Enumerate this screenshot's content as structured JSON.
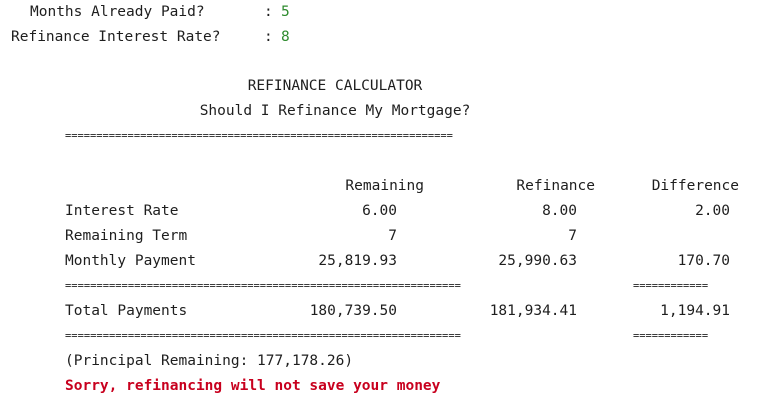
{
  "prompts": {
    "months_label": "Months Already Paid?",
    "months_sep": ":",
    "months_value": "5",
    "rate_label": "Refinance Interest Rate?",
    "rate_sep": ":",
    "rate_value": "8"
  },
  "header": {
    "title": "REFINANCE CALCULATOR",
    "subtitle": "Should I Refinance My Mortgage?",
    "rule": "=============================================================="
  },
  "columns": {
    "remaining": "Remaining",
    "refinance": "Refinance",
    "difference": "Difference"
  },
  "rows": [
    {
      "label": "Interest Rate",
      "remaining": "6.00",
      "refinance": "8.00",
      "difference": "2.00"
    },
    {
      "label": "Remaining Term",
      "remaining": "7",
      "refinance": "7",
      "difference": ""
    },
    {
      "label": "Monthly Payment",
      "remaining": "25,819.93",
      "refinance": "25,990.63",
      "difference": "170.70"
    }
  ],
  "rules": {
    "main": "===============================================================",
    "diff": "============"
  },
  "totals": {
    "label": "Total Payments",
    "remaining": "180,739.50",
    "refinance": "181,934.41",
    "difference": "1,194.91"
  },
  "principal_note": "(Principal Remaining: 177,178.26)",
  "verdict": "Sorry, refinancing will not save your money",
  "colors": {
    "input_value": "#2e8b2e",
    "warning": "#c8001e",
    "text": "#1e1e1e"
  }
}
